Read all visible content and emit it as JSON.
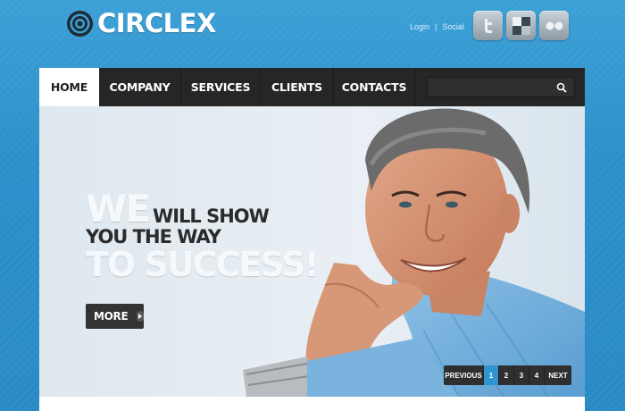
{
  "brand": {
    "name": "CIRCLEX"
  },
  "header": {
    "links": [
      "Login",
      "|",
      "Social"
    ],
    "socials": [
      {
        "icon": "twitter-icon"
      },
      {
        "icon": "delicious-icon"
      },
      {
        "icon": "flickr-icon"
      }
    ]
  },
  "nav": {
    "items": [
      "HOME",
      "COMPANY",
      "SERVICES",
      "CLIENTS",
      "CONTACTS"
    ],
    "active": "HOME",
    "search_placeholder": ""
  },
  "hero": {
    "we": "WE",
    "will_show": "WILL SHOW",
    "you_the_way": "YOU THE WAY",
    "to_success": "TO SUCCESS!",
    "more_label": "MORE"
  },
  "pager": {
    "previous": "PREVIOUS",
    "pages": [
      "1",
      "2",
      "3",
      "4"
    ],
    "active": "1",
    "next": "NEXT"
  },
  "colors": {
    "accent": "#2f95cf",
    "nav_bg": "#262626",
    "sky": "#3ba0d6"
  }
}
